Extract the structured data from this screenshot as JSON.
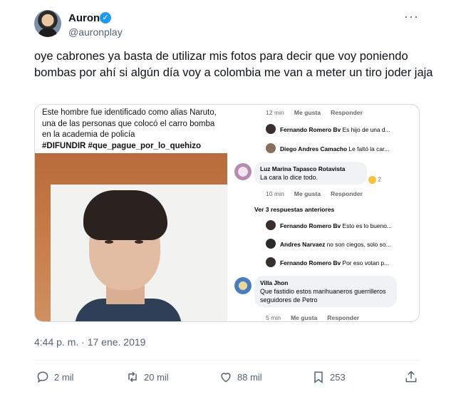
{
  "author": {
    "name": "Auron",
    "handle": "@auronplay",
    "verified_icon": "verified-badge-icon"
  },
  "tweet": {
    "text": "oye cabrones ya basta de utilizar mis fotos para decir que voy poniendo bombas por ahí si algún día voy a colombia me van a meter un tiro joder jaja",
    "timestamp": "4:44 p. m. · 17 ene. 2019"
  },
  "media": {
    "caption_text": "Este hombre fue identificado como alias Naruto, una de las personas que colocó el carro bomba en la academia de policía",
    "caption_tags": "#DIFUNDIR #que_pague_por_lo_quehizo",
    "comments": {
      "top_meta": {
        "time": "12 min",
        "like": "Me gusta",
        "reply": "Responder"
      },
      "replies_top": [
        {
          "name": "Fernando Romero Bv",
          "text": "Es hijo de una d..."
        },
        {
          "name": "Diego Andres Camacho",
          "text": "Le faltó la car..."
        }
      ],
      "comment1": {
        "name": "Luz Marina Tapasco Rotavista",
        "text": "La cara lo dice todo.",
        "reactions": "2",
        "meta": {
          "time": "10 min",
          "like": "Me gusta",
          "reply": "Responder"
        }
      },
      "more_replies": "Ver 3 respuestas anteriores",
      "replies_mid": [
        {
          "name": "Fernando Romero Bv",
          "text": "Esto es lo bueno..."
        },
        {
          "name": "Andres Narvaez",
          "text": "no son ciegos, solo so..."
        },
        {
          "name": "Fernando Romero Bv",
          "text": "Por eso votan p..."
        }
      ],
      "comment2": {
        "name": "Villa Jhon",
        "text": "Que fastidio estos marihuaneros guerrilleros seguidores de Petro",
        "meta": {
          "time": "5 min",
          "like": "Me gusta",
          "reply": "Responder"
        }
      }
    }
  },
  "actions": {
    "reply_count": "2 mil",
    "retweet_count": "20 mil",
    "like_count": "88 mil",
    "views_count": "253"
  },
  "colors": {
    "text_primary": "#0f1419",
    "text_secondary": "#536471",
    "border": "#cfd9de",
    "verified": "#1d9bf0"
  }
}
